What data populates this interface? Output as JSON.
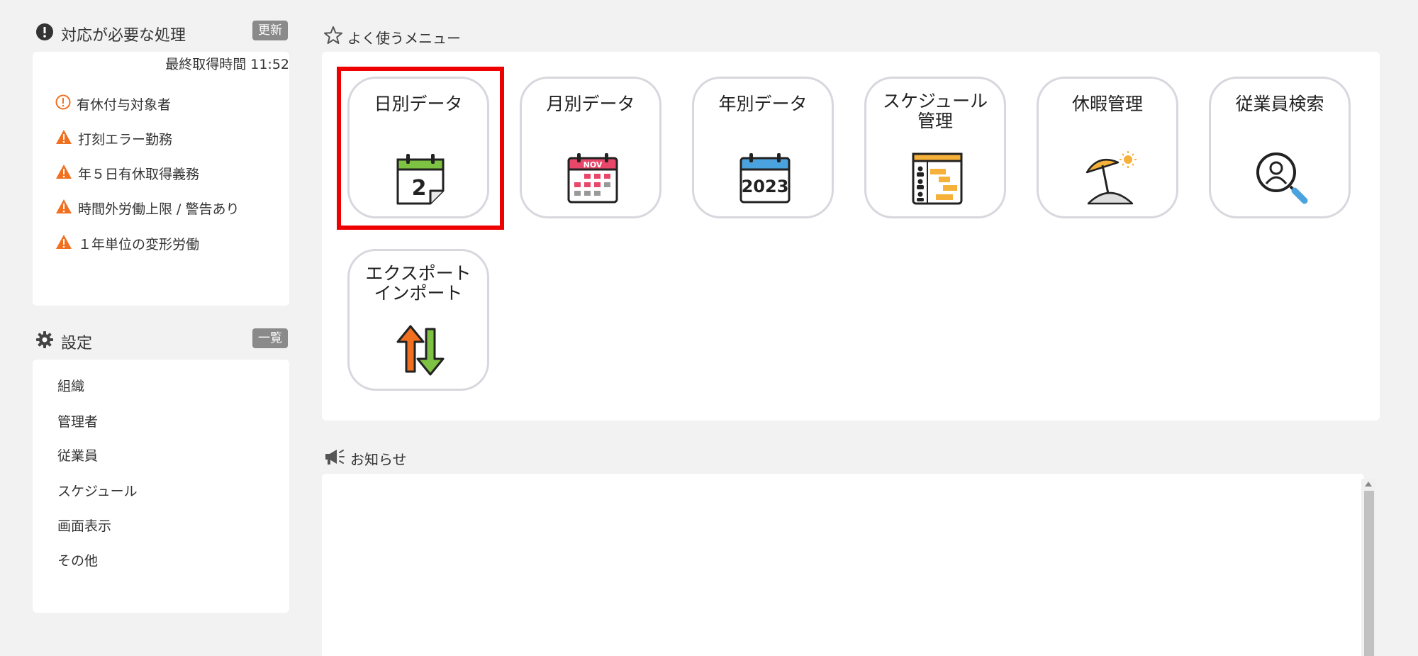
{
  "alerts": {
    "title": "対応が必要な処理",
    "refresh_label": "更新",
    "last_fetched": "最終取得時間 11:52",
    "items": [
      {
        "label": "有休付与対象者",
        "icon": "info-circle-icon"
      },
      {
        "label": "打刻エラー勤務",
        "icon": "warning-icon"
      },
      {
        "label": "年５日有休取得義務",
        "icon": "warning-icon"
      },
      {
        "label": "時間外労働上限 / 警告あり",
        "icon": "warning-icon"
      },
      {
        "label": "１年単位の変形労働",
        "icon": "warning-icon"
      }
    ]
  },
  "settings": {
    "title": "設定",
    "list_label": "一覧",
    "items": [
      "組織",
      "管理者",
      "従業員",
      "スケジュール",
      "画面表示",
      "その他"
    ]
  },
  "menu": {
    "title": "よく使うメニュー",
    "tiles": [
      {
        "label": "日別データ",
        "icon": "daily-calendar-icon",
        "number": "2"
      },
      {
        "label": "月別データ",
        "icon": "monthly-calendar-icon",
        "month": "NOV"
      },
      {
        "label": "年別データ",
        "icon": "yearly-calendar-icon",
        "year": "2023"
      },
      {
        "label1": "スケジュール",
        "label2": "管理",
        "icon": "schedule-chart-icon"
      },
      {
        "label": "休暇管理",
        "icon": "beach-umbrella-icon"
      },
      {
        "label": "従業員検索",
        "icon": "employee-search-icon"
      },
      {
        "label1": "エクスポート",
        "label2": "インポート",
        "icon": "export-import-arrows-icon"
      }
    ]
  },
  "news": {
    "title": "お知らせ"
  },
  "colors": {
    "highlight": "#ee0000",
    "warning": "#f07020",
    "calendar_green": "#7dc242",
    "calendar_red": "#e8476a",
    "calendar_blue": "#4aa3df",
    "schedule_orange": "#f6b13a"
  }
}
